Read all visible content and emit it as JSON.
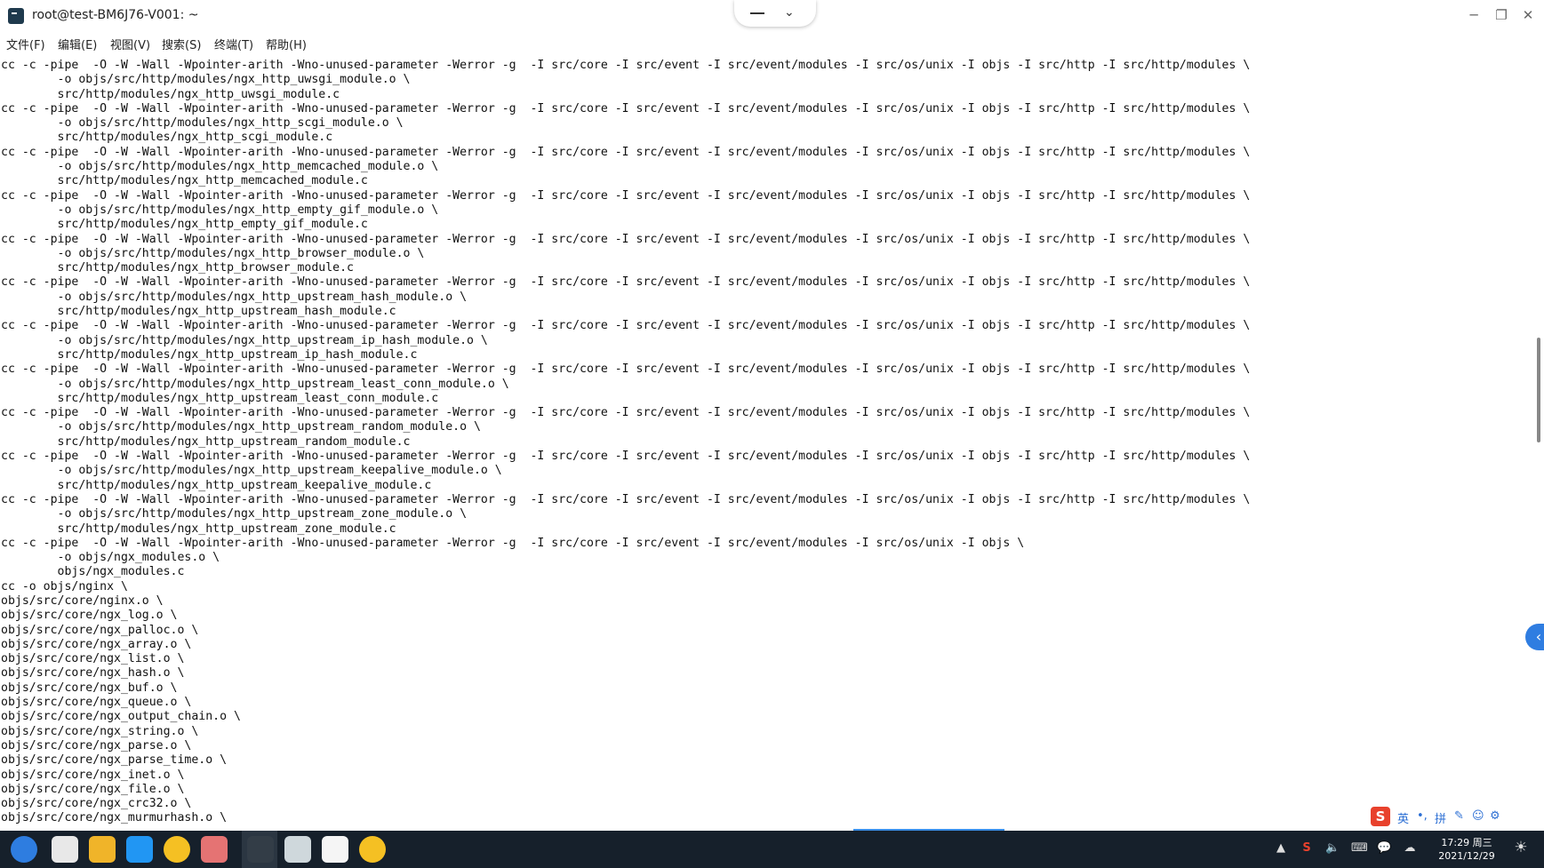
{
  "window": {
    "title": "root@test-BM6J76-V001: ~",
    "controls": {
      "minimize": "─",
      "maximize": "❐",
      "close": "✕"
    }
  },
  "center_pill": {
    "chevron": "⌄"
  },
  "menu": [
    "文件(F)",
    "编辑(E)",
    "视图(V)",
    "搜索(S)",
    "终端(T)",
    "帮助(H)"
  ],
  "terminal_lines": [
    "cc -c -pipe  -O -W -Wall -Wpointer-arith -Wno-unused-parameter -Werror -g  -I src/core -I src/event -I src/event/modules -I src/os/unix -I objs -I src/http -I src/http/modules \\",
    "        -o objs/src/http/modules/ngx_http_uwsgi_module.o \\",
    "        src/http/modules/ngx_http_uwsgi_module.c",
    "cc -c -pipe  -O -W -Wall -Wpointer-arith -Wno-unused-parameter -Werror -g  -I src/core -I src/event -I src/event/modules -I src/os/unix -I objs -I src/http -I src/http/modules \\",
    "        -o objs/src/http/modules/ngx_http_scgi_module.o \\",
    "        src/http/modules/ngx_http_scgi_module.c",
    "cc -c -pipe  -O -W -Wall -Wpointer-arith -Wno-unused-parameter -Werror -g  -I src/core -I src/event -I src/event/modules -I src/os/unix -I objs -I src/http -I src/http/modules \\",
    "        -o objs/src/http/modules/ngx_http_memcached_module.o \\",
    "        src/http/modules/ngx_http_memcached_module.c",
    "cc -c -pipe  -O -W -Wall -Wpointer-arith -Wno-unused-parameter -Werror -g  -I src/core -I src/event -I src/event/modules -I src/os/unix -I objs -I src/http -I src/http/modules \\",
    "        -o objs/src/http/modules/ngx_http_empty_gif_module.o \\",
    "        src/http/modules/ngx_http_empty_gif_module.c",
    "cc -c -pipe  -O -W -Wall -Wpointer-arith -Wno-unused-parameter -Werror -g  -I src/core -I src/event -I src/event/modules -I src/os/unix -I objs -I src/http -I src/http/modules \\",
    "        -o objs/src/http/modules/ngx_http_browser_module.o \\",
    "        src/http/modules/ngx_http_browser_module.c",
    "cc -c -pipe  -O -W -Wall -Wpointer-arith -Wno-unused-parameter -Werror -g  -I src/core -I src/event -I src/event/modules -I src/os/unix -I objs -I src/http -I src/http/modules \\",
    "        -o objs/src/http/modules/ngx_http_upstream_hash_module.o \\",
    "        src/http/modules/ngx_http_upstream_hash_module.c",
    "cc -c -pipe  -O -W -Wall -Wpointer-arith -Wno-unused-parameter -Werror -g  -I src/core -I src/event -I src/event/modules -I src/os/unix -I objs -I src/http -I src/http/modules \\",
    "        -o objs/src/http/modules/ngx_http_upstream_ip_hash_module.o \\",
    "        src/http/modules/ngx_http_upstream_ip_hash_module.c",
    "cc -c -pipe  -O -W -Wall -Wpointer-arith -Wno-unused-parameter -Werror -g  -I src/core -I src/event -I src/event/modules -I src/os/unix -I objs -I src/http -I src/http/modules \\",
    "        -o objs/src/http/modules/ngx_http_upstream_least_conn_module.o \\",
    "        src/http/modules/ngx_http_upstream_least_conn_module.c",
    "cc -c -pipe  -O -W -Wall -Wpointer-arith -Wno-unused-parameter -Werror -g  -I src/core -I src/event -I src/event/modules -I src/os/unix -I objs -I src/http -I src/http/modules \\",
    "        -o objs/src/http/modules/ngx_http_upstream_random_module.o \\",
    "        src/http/modules/ngx_http_upstream_random_module.c",
    "cc -c -pipe  -O -W -Wall -Wpointer-arith -Wno-unused-parameter -Werror -g  -I src/core -I src/event -I src/event/modules -I src/os/unix -I objs -I src/http -I src/http/modules \\",
    "        -o objs/src/http/modules/ngx_http_upstream_keepalive_module.o \\",
    "        src/http/modules/ngx_http_upstream_keepalive_module.c",
    "cc -c -pipe  -O -W -Wall -Wpointer-arith -Wno-unused-parameter -Werror -g  -I src/core -I src/event -I src/event/modules -I src/os/unix -I objs -I src/http -I src/http/modules \\",
    "        -o objs/src/http/modules/ngx_http_upstream_zone_module.o \\",
    "        src/http/modules/ngx_http_upstream_zone_module.c",
    "cc -c -pipe  -O -W -Wall -Wpointer-arith -Wno-unused-parameter -Werror -g  -I src/core -I src/event -I src/event/modules -I src/os/unix -I objs \\",
    "        -o objs/ngx_modules.o \\",
    "        objs/ngx_modules.c",
    "cc -o objs/nginx \\",
    "objs/src/core/nginx.o \\",
    "objs/src/core/ngx_log.o \\",
    "objs/src/core/ngx_palloc.o \\",
    "objs/src/core/ngx_array.o \\",
    "objs/src/core/ngx_list.o \\",
    "objs/src/core/ngx_hash.o \\",
    "objs/src/core/ngx_buf.o \\",
    "objs/src/core/ngx_queue.o \\",
    "objs/src/core/ngx_output_chain.o \\",
    "objs/src/core/ngx_string.o \\",
    "objs/src/core/ngx_parse.o \\",
    "objs/src/core/ngx_parse_time.o \\",
    "objs/src/core/ngx_inet.o \\",
    "objs/src/core/ngx_file.o \\",
    "objs/src/core/ngx_crc32.o \\",
    "objs/src/core/ngx_murmurhash.o \\"
  ],
  "ime": {
    "logo": "S",
    "items": [
      "英",
      "•,",
      "拼",
      "✎",
      "☺",
      "⚙"
    ]
  },
  "taskbar": {
    "apps": [
      {
        "name": "launcher-icon",
        "color": "#2e7de0"
      },
      {
        "name": "multitask-icon",
        "color": "#e8e8e8"
      },
      {
        "name": "file-manager-icon",
        "color": "#f0b429"
      },
      {
        "name": "app-store-icon",
        "color": "#2196f3"
      },
      {
        "name": "browser-icon",
        "color": "#f5c023"
      },
      {
        "name": "camera-icon",
        "color": "#e57373"
      },
      {
        "name": "terminal-icon",
        "color": "#333d47"
      },
      {
        "name": "system-monitor-icon",
        "color": "#cfd8dc"
      },
      {
        "name": "text-editor-icon",
        "color": "#f5f5f5"
      },
      {
        "name": "browser-2-icon",
        "color": "#f5c023"
      }
    ],
    "tray": [
      "▲",
      "S",
      "🔈",
      "⌨",
      "💬",
      "☁"
    ],
    "clock": {
      "time": "17:29 周三",
      "date": "2021/12/29"
    },
    "notification": "☀"
  }
}
